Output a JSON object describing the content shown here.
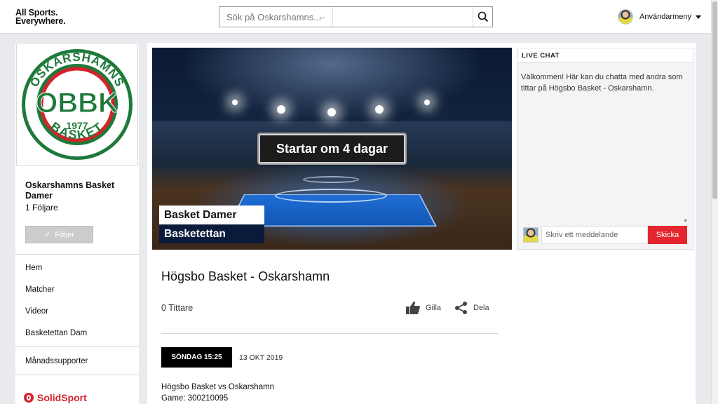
{
  "header": {
    "brand_line1": "All Sports.",
    "brand_line2": "Everywhere.",
    "search_placeholder": "Sök på Oskarshamns...",
    "user_menu_label": "Användarmeny"
  },
  "sidebar": {
    "logo": {
      "top_text": "OSKARSHAMNS",
      "initials": "OBBK",
      "year": "1977",
      "bottom_text": "BASKET"
    },
    "team_name": "Oskarshamns Basket Damer",
    "followers": "1 Följare",
    "follow_button": "Följer",
    "nav": [
      {
        "label": "Hem"
      },
      {
        "label": "Matcher"
      },
      {
        "label": "Videor"
      },
      {
        "label": "Basketettan Dam"
      }
    ],
    "monthly_supporter": "Månadssupporter",
    "provider": "SolidSport"
  },
  "video": {
    "status_badge": "Startar om 4 dagar",
    "overlay_title": "Basket Damer",
    "overlay_subtitle": "Basketettan"
  },
  "chat": {
    "header": "LIVE CHAT",
    "welcome": "Välkommen! Här kan du chatta med andra som tittar på Högsbo Basket - Oskarshamn.",
    "input_placeholder": "Skriv ett meddelande",
    "send_label": "Skicka"
  },
  "game": {
    "title": "Högsbo Basket - Oskarshamn",
    "viewers": "0 Tittare",
    "like_label": "Gilla",
    "share_label": "Dela",
    "day_time": "SÖNDAG 15:25",
    "date": "13 OKT 2019",
    "desc_line1": "Högsbo Basket vs Oskarshamn",
    "desc_line2": "Game: 300210095"
  },
  "colors": {
    "accent_red": "#e5262e",
    "logo_green": "#1d7a3a",
    "logo_red": "#d4232b",
    "badge_black": "#000000"
  }
}
